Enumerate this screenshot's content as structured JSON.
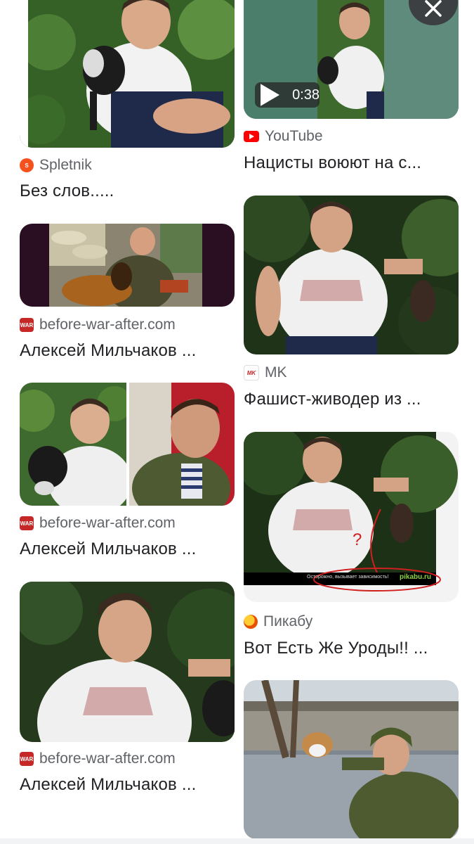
{
  "results": {
    "left": [
      {
        "source": "Spletnik",
        "title": "Без слов....."
      },
      {
        "source": "before-war-after.com",
        "title": "Алексей Мильчаков ..."
      },
      {
        "source": "before-war-after.com",
        "title": "Алексей Мильчаков ..."
      },
      {
        "source": "before-war-after.com",
        "title": "Алексей Мильчаков ..."
      }
    ],
    "right": [
      {
        "source": "YouTube",
        "title": "Нацисты воюют на с...",
        "duration": "0:38"
      },
      {
        "source": "MK",
        "title": "Фашист-живодер из ..."
      },
      {
        "source": "Пикабу",
        "title": "Вот Есть Же Уроды!! ..."
      },
      {
        "source": "",
        "title": ""
      }
    ]
  },
  "favicons": {
    "spletnik": "S",
    "war": "WAR",
    "mk": "MK"
  },
  "image_texts": {
    "pikabu_watermark": "pikabu.ru",
    "pikabu_caption": "Осторожно, вызывает зависимость!",
    "question_mark": "?"
  },
  "icons": {
    "close": "close-icon",
    "play": "play-icon",
    "youtube": "youtube-icon"
  },
  "colors": {
    "youtube_red": "#ff0000",
    "spletnik_orange": "#f4511e",
    "war_red": "#c62828",
    "text_primary": "#202124",
    "text_secondary": "#5f6368"
  }
}
